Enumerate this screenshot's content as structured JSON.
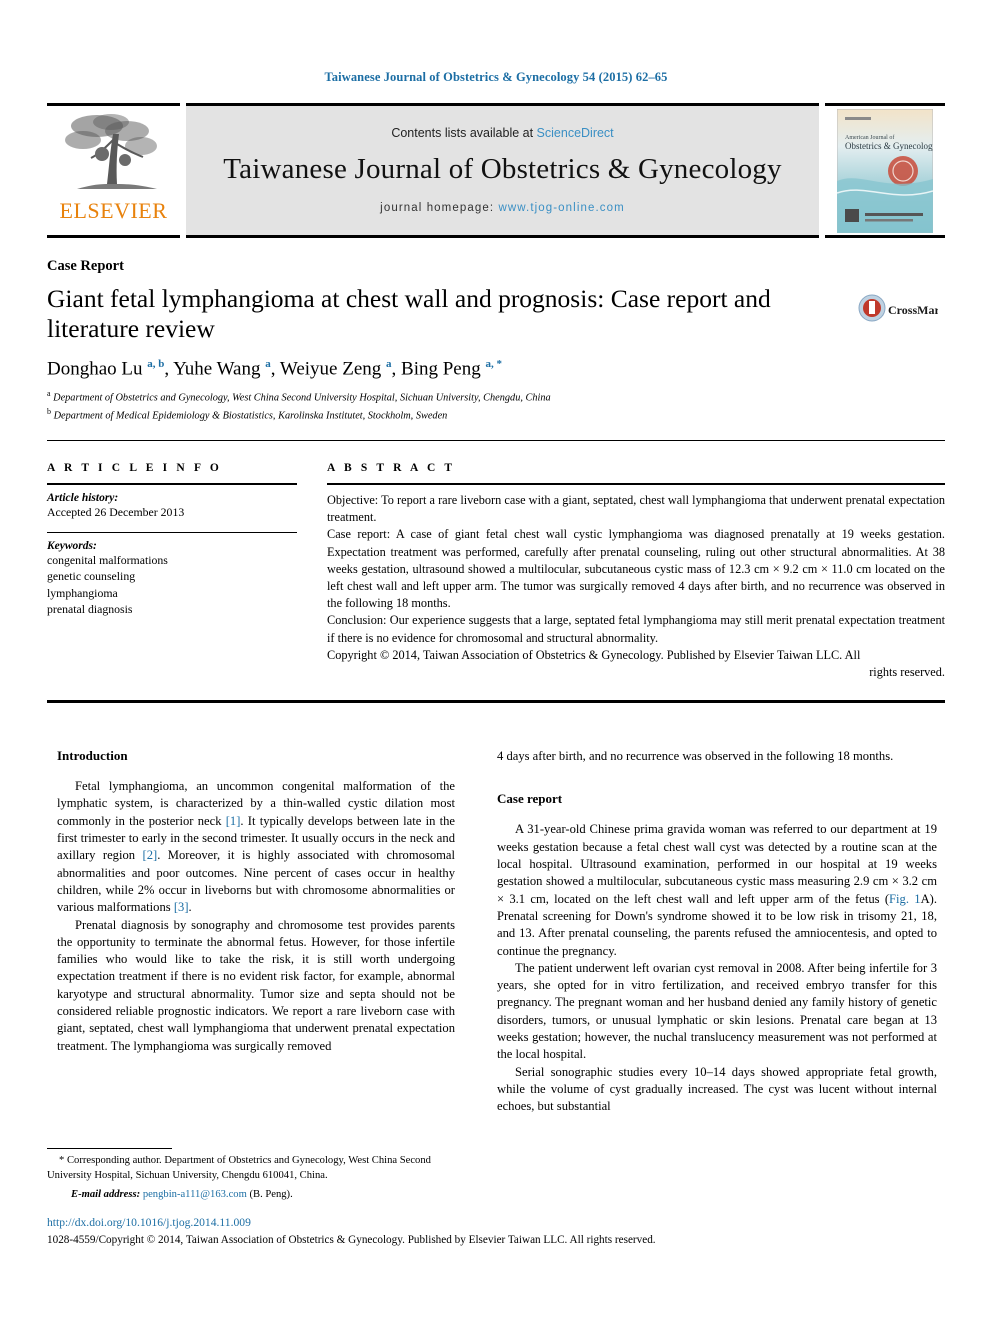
{
  "running_head": "Taiwanese Journal of Obstetrics & Gynecology 54 (2015) 62–65",
  "header": {
    "publisher_name": "ELSEVIER",
    "contents_prefix": "Contents lists available at ",
    "contents_link": "ScienceDirect",
    "journal_title": "Taiwanese Journal of Obstetrics & Gynecology",
    "homepage_prefix": "journal homepage: ",
    "homepage_url": "www.tjog-online.com",
    "cover_line1": "American Journal of",
    "cover_line2": "Obstetrics & Gynecology"
  },
  "article": {
    "type_label": "Case Report",
    "title": "Giant fetal lymphangioma at chest wall and prognosis: Case report and literature review",
    "crossmark_label": "CrossMark",
    "authors_html": "Donghao Lu <sup>a, b</sup>, Yuhe Wang <sup>a</sup>, Weiyue Zeng <sup>a</sup>, Bing Peng <sup>a, *</sup>",
    "affiliation_a": "Department of Obstetrics and Gynecology, West China Second University Hospital, Sichuan University, Chengdu, China",
    "affiliation_b": "Department of Medical Epidemiology & Biostatistics, Karolinska Institutet, Stockholm, Sweden"
  },
  "article_info": {
    "heading": "A R T I C L E   I N F O",
    "history_label": "Article history:",
    "history_value": "Accepted 26 December 2013",
    "keywords_label": "Keywords:",
    "keywords": [
      "congenital malformations",
      "genetic counseling",
      "lymphangioma",
      "prenatal diagnosis"
    ]
  },
  "abstract": {
    "heading": "A B S T R A C T",
    "objective_label": "Objective:",
    "objective_text": "To report a rare liveborn case with a giant, septated, chest wall lymphangioma that underwent prenatal expectation treatment.",
    "case_label": "Case report:",
    "case_text": "A case of giant fetal chest wall cystic lymphangioma was diagnosed prenatally at 19 weeks gestation. Expectation treatment was performed, carefully after prenatal counseling, ruling out other structural abnormalities. At 38 weeks gestation, ultrasound showed a multilocular, subcutaneous cystic mass of 12.3 cm × 9.2 cm × 11.0 cm located on the left chest wall and left upper arm. The tumor was surgically removed 4 days after birth, and no recurrence was observed in the following 18 months.",
    "conclusion_label": "Conclusion:",
    "conclusion_text": "Our experience suggests that a large, septated fetal lymphangioma may still merit prenatal expectation treatment if there is no evidence for chromosomal and structural abnormality.",
    "copyright_text": "Copyright © 2014, Taiwan Association of Obstetrics & Gynecology. Published by Elsevier Taiwan LLC. All",
    "copyright_tail": "rights reserved."
  },
  "body": {
    "introduction_heading": "Introduction",
    "intro_p1_a": "Fetal lymphangioma, an uncommon congenital malformation of the lymphatic system, is characterized by a thin-walled cystic dilation most commonly in the posterior neck ",
    "intro_p1_ref1": "[1]",
    "intro_p1_b": ". It typically develops between late in the first trimester to early in the second trimester. It usually occurs in the neck and axillary region ",
    "intro_p1_ref2": "[2]",
    "intro_p1_c": ". Moreover, it is highly associated with chromosomal abnormalities and poor outcomes. Nine percent of cases occur in healthy children, while 2% occur in liveborns but with chromosome abnormalities or various malformations ",
    "intro_p1_ref3": "[3]",
    "intro_p1_d": ".",
    "intro_p2": "Prenatal diagnosis by sonography and chromosome test provides parents the opportunity to terminate the abnormal fetus. However, for those infertile families who would like to take the risk, it is still worth undergoing expectation treatment if there is no evident risk factor, for example, abnormal karyotype and structural abnormality. Tumor size and septa should not be considered reliable prognostic indicators. We report a rare liveborn case with giant, septated, chest wall lymphangioma that underwent prenatal expectation treatment. The lymphangioma was surgically removed",
    "intro_p2_cont": "4 days after birth, and no recurrence was observed in the following 18 months.",
    "case_heading": "Case report",
    "case_p1_a": "A 31-year-old Chinese prima gravida woman was referred to our department at 19 weeks gestation because a fetal chest wall cyst was detected by a routine scan at the local hospital. Ultrasound examination, performed in our hospital at 19 weeks gestation showed a multilocular, subcutaneous cystic mass measuring 2.9 cm × 3.2 cm × 3.1 cm, located on the left chest wall and left upper arm of the fetus (",
    "case_p1_figref": "Fig. 1",
    "case_p1_b": "A). Prenatal screening for Down's syndrome showed it to be low risk in trisomy 21, 18, and 13. After prenatal counseling, the parents refused the amniocentesis, and opted to continue the pregnancy.",
    "case_p2": "The patient underwent left ovarian cyst removal in 2008. After being infertile for 3 years, she opted for in vitro fertilization, and received embryo transfer for this pregnancy. The pregnant woman and her husband denied any family history of genetic disorders, tumors, or unusual lymphatic or skin lesions. Prenatal care began at 13 weeks gestation; however, the nuchal translucency measurement was not performed at the local hospital.",
    "case_p3": "Serial sonographic studies every 10–14 days showed appropriate fetal growth, while the volume of cyst gradually increased. The cyst was lucent without internal echoes, but substantial"
  },
  "footer": {
    "corresponding_marker": "*",
    "corresponding_text": "Corresponding author. Department of Obstetrics and Gynecology, West China Second University Hospital, Sichuan University, Chengdu 610041, China.",
    "email_label": "E-mail address:",
    "email_address": "pengbin-a111@163.com",
    "email_owner": "(B. Peng).",
    "doi": "http://dx.doi.org/10.1016/j.tjog.2014.11.009",
    "issn_copyright": "1028-4559/Copyright © 2014, Taiwan Association of Obstetrics & Gynecology. Published by Elsevier Taiwan LLC. All rights reserved."
  },
  "colors": {
    "link_blue": "#1c6ea4",
    "elsevier_orange": "#e8820c",
    "band_gray": "#e3e3e3"
  }
}
